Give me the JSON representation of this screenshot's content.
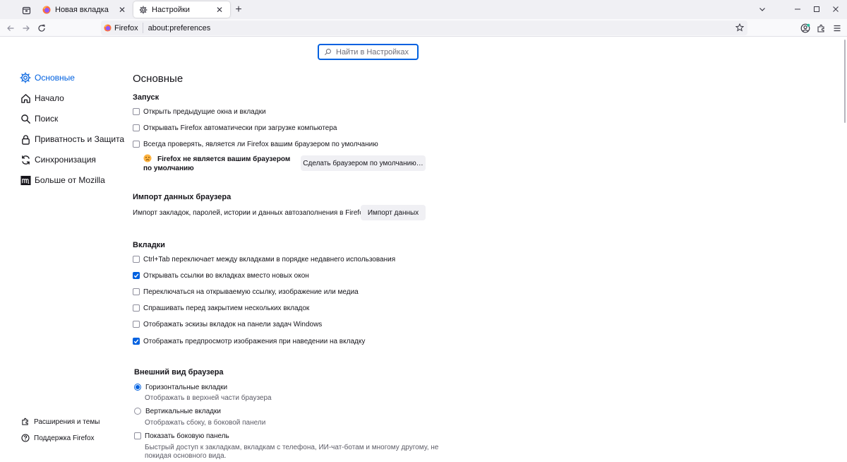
{
  "tabs": [
    {
      "label": "Новая вкладка",
      "favicon": "firefox-icon"
    },
    {
      "label": "Настройки",
      "favicon": "gear-icon",
      "active": true
    }
  ],
  "urlbar": {
    "identity_label": "Firefox",
    "url": "about:preferences"
  },
  "search": {
    "placeholder": "Найти в Настройках"
  },
  "sidebar": {
    "categories": [
      {
        "label": "Основные",
        "icon": "gear-icon",
        "selected": true
      },
      {
        "label": "Начало",
        "icon": "home-icon"
      },
      {
        "label": "Поиск",
        "icon": "search-icon"
      },
      {
        "label": "Приватность и Защита",
        "icon": "lock-icon"
      },
      {
        "label": "Синхронизация",
        "icon": "sync-icon"
      },
      {
        "label": "Больше от Mozilla",
        "icon": "mozilla-icon"
      }
    ],
    "footer": [
      {
        "label": "Расширения и темы",
        "icon": "puzzle-icon"
      },
      {
        "label": "Поддержка Firefox",
        "icon": "help-icon"
      }
    ]
  },
  "main": {
    "title": "Основные",
    "startup": {
      "heading": "Запуск",
      "options": [
        {
          "label": "Открыть предыдущие окна и вкладки",
          "checked": false
        },
        {
          "label": "Открывать Firefox автоматически при загрузке компьютера",
          "checked": false
        },
        {
          "label": "Всегда проверять, является ли Firefox вашим браузером по умолчанию",
          "checked": false
        }
      ],
      "not_default_text": "Firefox не является вашим браузером по умолчанию",
      "make_default_button": "Сделать браузером по умолчанию…"
    },
    "import": {
      "heading": "Импорт данных браузера",
      "description": "Импорт закладок, паролей, истории и данных автозаполнения в Firefox.",
      "button": "Импорт данных"
    },
    "tabs_section": {
      "heading": "Вкладки",
      "options": [
        {
          "label": "Ctrl+Tab переключает между вкладками в порядке недавнего использования",
          "checked": false
        },
        {
          "label": "Открывать ссылки во вкладках вместо новых окон",
          "checked": true
        },
        {
          "label": "Переключаться на открываемую ссылку, изображение или медиа",
          "checked": false
        },
        {
          "label": "Спрашивать перед закрытием нескольких вкладок",
          "checked": false
        },
        {
          "label": "Отображать эскизы вкладок на панели задач Windows",
          "checked": false
        },
        {
          "label": "Отображать предпросмотр изображения при наведении на вкладку",
          "checked": true
        }
      ]
    },
    "appearance": {
      "heading": "Внешний вид браузера",
      "layout_options": [
        {
          "label": "Горизонтальные вкладки",
          "description": "Отображать в верхней части браузера",
          "checked": true
        },
        {
          "label": "Вертикальные вкладки",
          "description": "Отображать сбоку, в боковой панели",
          "checked": false
        }
      ],
      "sidebar_option": {
        "label": "Показать боковую панель",
        "checked": false,
        "description_line1": "Быстрый доступ к закладкам, вкладкам с телефона, ИИ-чат-ботам и многому другому, не",
        "description_line2": "покидая основного вида."
      }
    }
  },
  "colors": {
    "accent": "#0061e0",
    "tabstrip_bg": "#f0f0f4",
    "button_bg": "#f0f0f4"
  }
}
